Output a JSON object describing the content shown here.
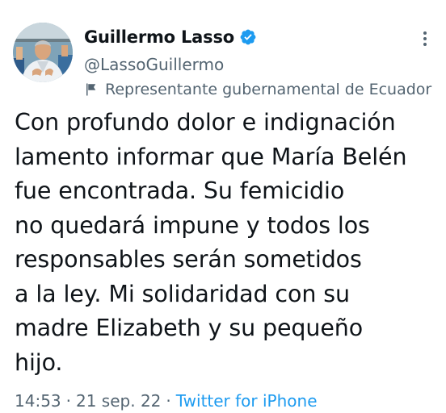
{
  "author": {
    "display_name": "Guillermo Lasso",
    "handle": "@LassoGuillermo",
    "label": "Representante gubernamental de Ecuador",
    "verified": true,
    "verified_color": "#1d9bf0"
  },
  "icons": {
    "avatar": "profile-photo",
    "verified": "verified-badge-icon",
    "label": "flag-icon",
    "more": "more-options-icon"
  },
  "tweet": {
    "lines": [
      "Con profundo dolor e indignación",
      "lamento informar que María Belén",
      "fue encontrada. Su femicidio",
      "no quedará impune y todos los",
      "responsables serán sometidos",
      "a la ley. Mi solidaridad con su",
      "madre Elizabeth y su pequeño",
      "hijo."
    ]
  },
  "meta": {
    "time": "14:53",
    "separator": "·",
    "date": "21 sep. 22",
    "source": "Twitter for iPhone",
    "source_color": "#1d9bf0"
  },
  "colors": {
    "text_primary": "#0f1419",
    "text_secondary": "#536471",
    "link": "#1d9bf0",
    "background": "#ffffff"
  }
}
